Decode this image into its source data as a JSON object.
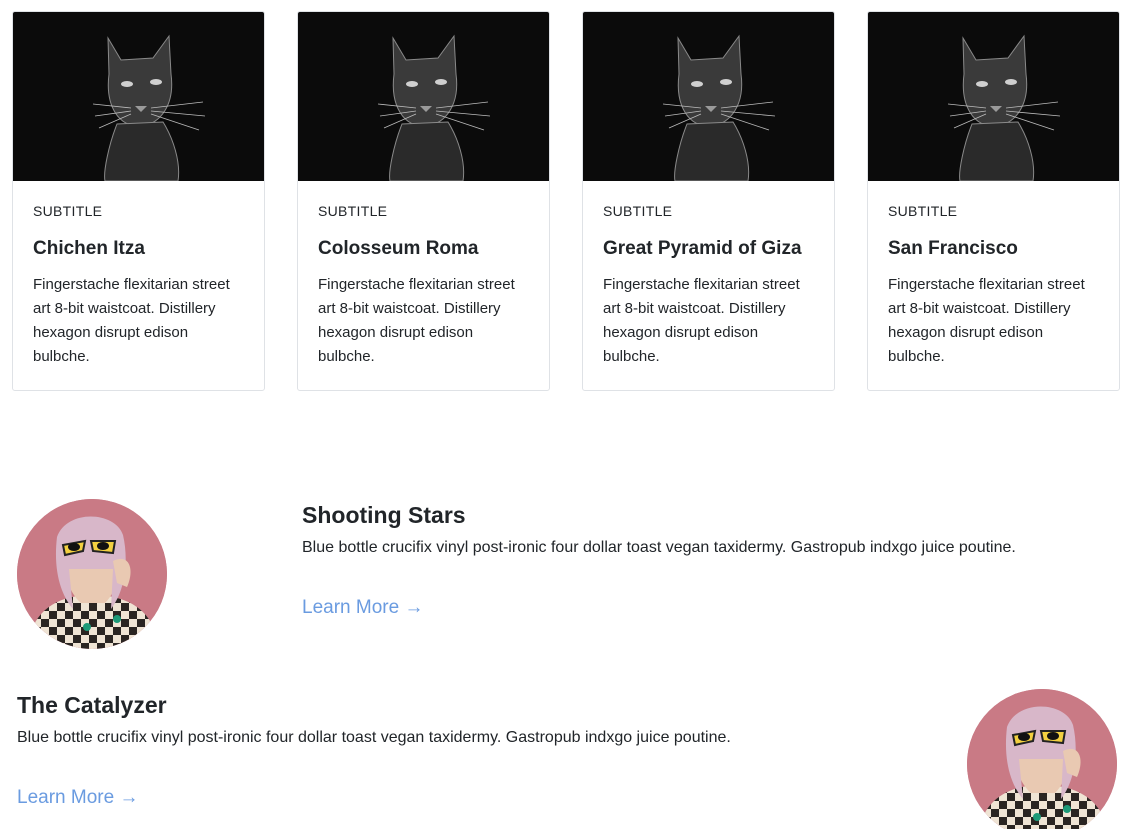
{
  "cards": [
    {
      "subtitle": "SUBTITLE",
      "title": "Chichen Itza",
      "text": "Fingerstache flexitarian street art 8-bit waistcoat. Distillery hexagon disrupt edison bulbche."
    },
    {
      "subtitle": "SUBTITLE",
      "title": "Colosseum Roma",
      "text": "Fingerstache flexitarian street art 8-bit waistcoat. Distillery hexagon disrupt edison bulbche."
    },
    {
      "subtitle": "SUBTITLE",
      "title": "Great Pyramid of Giza",
      "text": "Fingerstache flexitarian street art 8-bit waistcoat. Distillery hexagon disrupt edison bulbche."
    },
    {
      "subtitle": "SUBTITLE",
      "title": "San Francisco",
      "text": "Fingerstache flexitarian street art 8-bit waistcoat. Distillery hexagon disrupt edison bulbche."
    }
  ],
  "features": [
    {
      "title": "Shooting Stars",
      "text": "Blue bottle crucifix vinyl post-ironic four dollar toast vegan taxidermy. Gastropub indxgo juice poutine.",
      "link_label": "Learn More →"
    },
    {
      "title": "The Catalyzer",
      "text": "Blue bottle crucifix vinyl post-ironic four dollar toast vegan taxidermy. Gastropub indxgo juice poutine.",
      "link_label": "Learn More →"
    }
  ],
  "colors": {
    "link": "#6a9be0",
    "card_border": "#dfe2e6",
    "image_background": "#0b0b0b",
    "avatar_background": "#c97a85"
  },
  "images": {
    "card_image": "cat-photo",
    "avatar_image": "person-with-sunglasses-photo"
  }
}
